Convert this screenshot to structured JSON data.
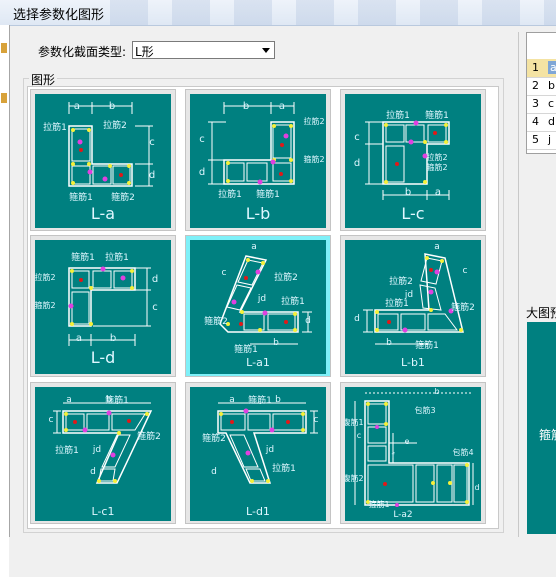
{
  "window": {
    "title": "选择参数化图形"
  },
  "section_type": {
    "label": "参数化截面类型:",
    "selected": "L形"
  },
  "group": {
    "label": "图形"
  },
  "tiles": [
    {
      "caption": "L-a",
      "labels": {
        "a": "a",
        "b": "b",
        "c": "c",
        "d": "d",
        "tj1": "拉筋1",
        "tj2": "拉筋2",
        "gj1": "箍筋1",
        "gj2": "箍筋2"
      }
    },
    {
      "caption": "L-b",
      "labels": {
        "a": "a",
        "b": "b",
        "c": "c",
        "d": "d",
        "tj1": "拉筋1",
        "tj2": "拉筋2",
        "gj1": "箍筋1",
        "gj2": "箍筋2"
      }
    },
    {
      "caption": "L-c",
      "labels": {
        "a": "a",
        "b": "b",
        "c": "c",
        "d": "d",
        "tj1": "拉筋1",
        "tj2": "拉筋2",
        "gj1": "箍筋1",
        "gj2": "箍筋2"
      }
    },
    {
      "caption": "L-d",
      "labels": {
        "a": "a",
        "b": "b",
        "c": "c",
        "d": "d",
        "tj1": "拉筋1",
        "tj2": "拉筋2",
        "gj1": "箍筋1",
        "gj2": "箍筋2"
      }
    },
    {
      "caption": "L-a1",
      "labels": {
        "a": "a",
        "b": "b",
        "c": "c",
        "d": "d",
        "jd": "jd",
        "tj1": "拉筋1",
        "tj2": "拉筋2",
        "gj1": "箍筋1",
        "gj2": "箍筋2"
      }
    },
    {
      "caption": "L-b1",
      "labels": {
        "a": "a",
        "b": "b",
        "c": "c",
        "d": "d",
        "jd": "jd",
        "tj1": "拉筋1",
        "tj2": "拉筋2",
        "gj1": "箍筋1",
        "gj2": "箍筋2"
      }
    },
    {
      "caption": "L-c1",
      "labels": {
        "a": "a",
        "b": "b",
        "c": "c",
        "d": "d",
        "jd": "jd",
        "tj1": "拉筋1",
        "gj1": "箍筋1",
        "gj2": "箍筋2"
      }
    },
    {
      "caption": "L-d1",
      "labels": {
        "a": "a",
        "b": "b",
        "c": "c",
        "d": "d",
        "jd": "jd",
        "tj1": "拉筋1",
        "gj1": "箍筋1",
        "gj2": "箍筋2"
      }
    },
    {
      "caption": "L-a2",
      "labels": {
        "b": "b",
        "c": "c",
        "d": "d",
        "e": "e",
        "f": "f",
        "bj3": "包筋3",
        "bj4": "包筋4",
        "gj1": "箍筋1",
        "yj1": "腹筋1",
        "yj2": "腹筋2"
      }
    }
  ],
  "right_table": {
    "rows": [
      {
        "num": "1",
        "text": "a"
      },
      {
        "num": "2",
        "text": "b"
      },
      {
        "num": "3",
        "text": "c"
      },
      {
        "num": "4",
        "text": "d"
      },
      {
        "num": "5",
        "text": "j"
      }
    ]
  },
  "preview": {
    "label": "大图预览",
    "panel_text": "箍筋"
  },
  "colors": {
    "tile_bg": "#008080",
    "line": "#ffffff",
    "rebar": "#f5f03a",
    "tie": "#e040e0",
    "center": "#e01818",
    "selected_border": "#7ff0f8"
  }
}
